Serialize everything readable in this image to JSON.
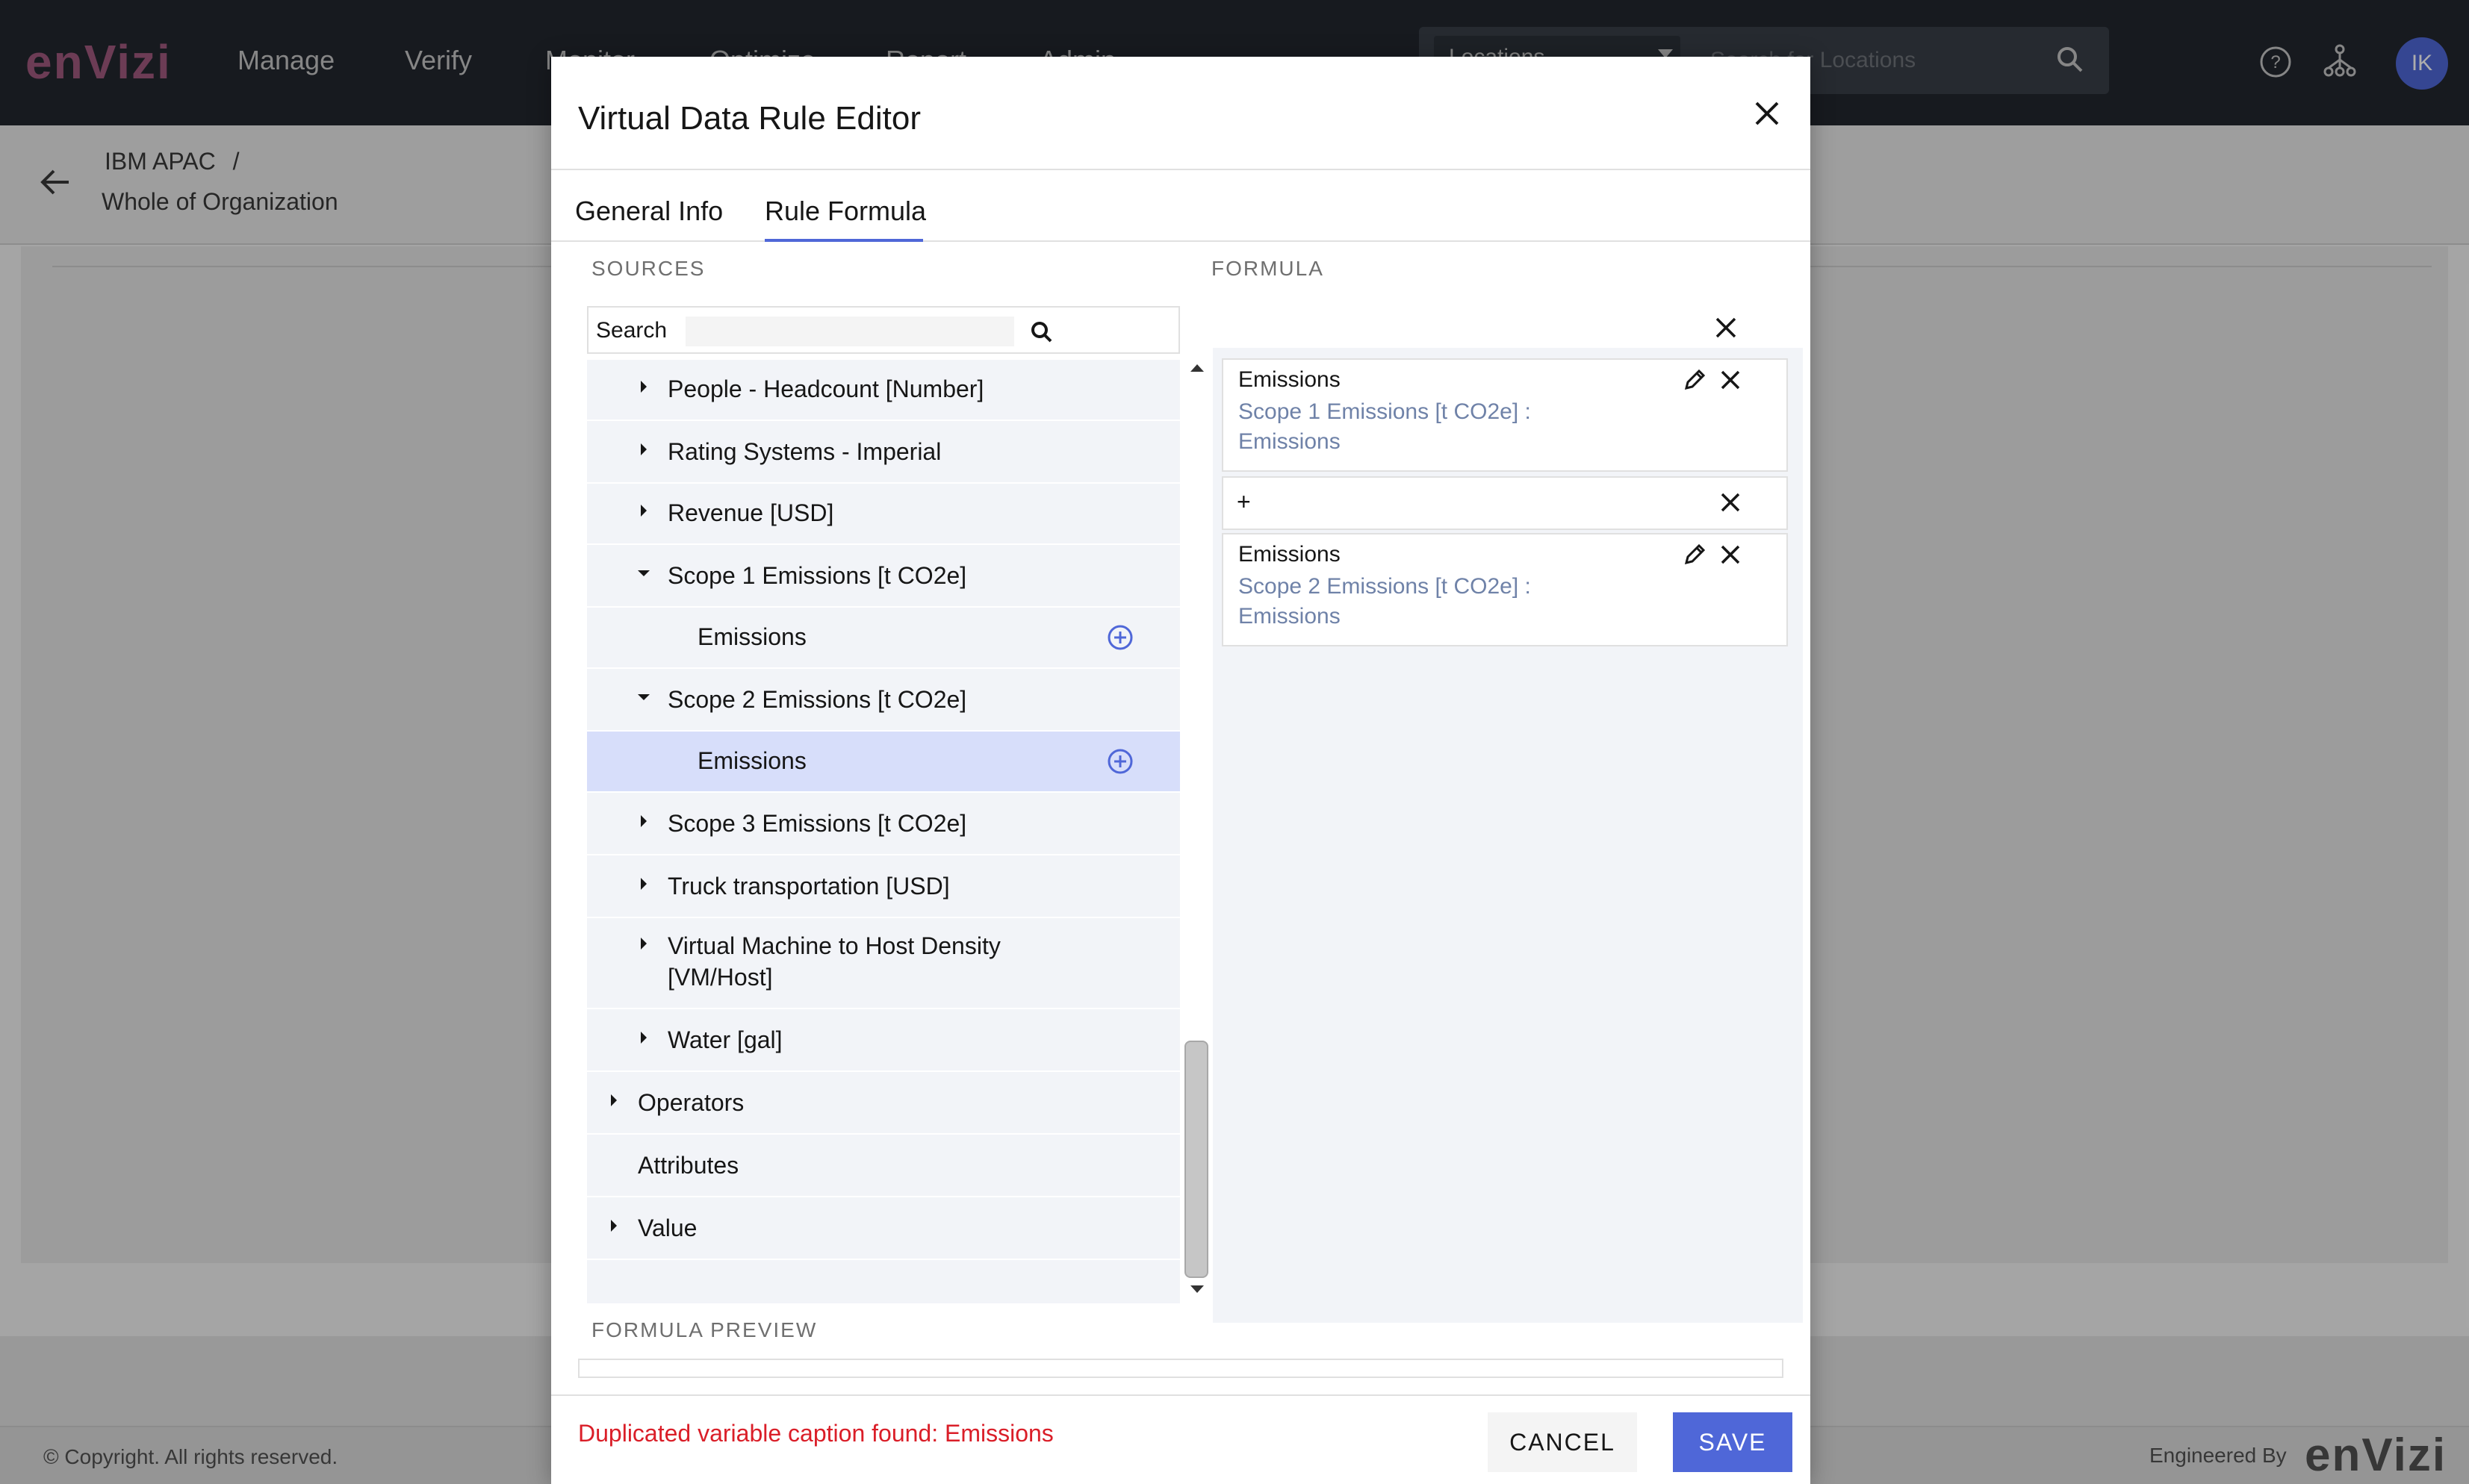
{
  "app": {
    "logo": "enVizi",
    "nav": [
      "Manage",
      "Verify",
      "Monitor",
      "Optimize",
      "Report",
      "Admin"
    ],
    "location_select": "Locations",
    "location_search_placeholder": "Search for Locations",
    "avatar_initials": "IK",
    "brand_color": "#4f67d8"
  },
  "breadcrumb": {
    "org": "IBM APAC",
    "separator": "/",
    "scope": "Whole of Organization"
  },
  "footer": {
    "copyright": "© Copyright. All rights reserved.",
    "engineered_by": "Engineered By",
    "logo": "enVizi"
  },
  "modal": {
    "title": "Virtual Data Rule Editor",
    "tabs": [
      {
        "label": "General Info",
        "active": false
      },
      {
        "label": "Rule Formula",
        "active": true
      }
    ],
    "sources_label": "SOURCES",
    "formula_label": "FORMULA",
    "search_label": "Search",
    "search_value": "",
    "tree": [
      {
        "label": "People - Headcount [Number]",
        "state": "collapsed"
      },
      {
        "label": "Rating Systems - Imperial",
        "state": "collapsed"
      },
      {
        "label": "Revenue [USD]",
        "state": "collapsed"
      },
      {
        "label": "Scope 1 Emissions [t CO2e]",
        "state": "expanded"
      },
      {
        "label": "Emissions",
        "state": "leaf"
      },
      {
        "label": "Scope 2 Emissions [t CO2e]",
        "state": "expanded"
      },
      {
        "label": "Emissions",
        "state": "leaf",
        "selected": true
      },
      {
        "label": "Scope 3 Emissions [t CO2e]",
        "state": "collapsed"
      },
      {
        "label": "Truck transportation [USD]",
        "state": "collapsed"
      },
      {
        "label": "Virtual Machine to Host Density [VM/Host]",
        "state": "collapsed"
      },
      {
        "label": "Water [gal]",
        "state": "collapsed"
      },
      {
        "label": "Operators",
        "state": "collapsed"
      },
      {
        "label": "Attributes",
        "state": "none"
      },
      {
        "label": "Value",
        "state": "collapsed"
      }
    ],
    "formula": [
      {
        "type": "variable",
        "caption": "Emissions",
        "source": "Scope 1 Emissions [t CO2e] :",
        "field": "Emissions"
      },
      {
        "type": "operator",
        "symbol": "+"
      },
      {
        "type": "variable",
        "caption": "Emissions",
        "source": "Scope 2 Emissions [t CO2e] :",
        "field": "Emissions"
      }
    ],
    "preview_label": "FORMULA PREVIEW",
    "preview_value": "",
    "error": "Duplicated variable caption found: Emissions",
    "cancel_label": "CANCEL",
    "save_label": "SAVE",
    "error_color": "#da1e28"
  }
}
